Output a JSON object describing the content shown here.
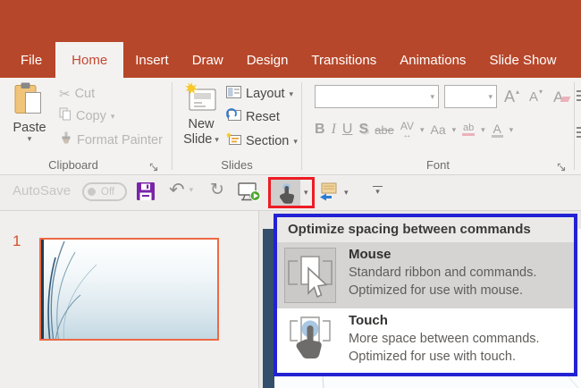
{
  "tabs": {
    "items": [
      {
        "label": "File"
      },
      {
        "label": "Home"
      },
      {
        "label": "Insert"
      },
      {
        "label": "Draw"
      },
      {
        "label": "Design"
      },
      {
        "label": "Transitions"
      },
      {
        "label": "Animations"
      },
      {
        "label": "Slide Show"
      }
    ],
    "active": "Home"
  },
  "ribbon": {
    "clipboard": {
      "group_label": "Clipboard",
      "paste_label": "Paste",
      "cut_label": "Cut",
      "copy_label": "Copy",
      "format_painter_label": "Format Painter"
    },
    "slides": {
      "group_label": "Slides",
      "new_slide_line1": "New",
      "new_slide_line2": "Slide",
      "layout_label": "Layout",
      "reset_label": "Reset",
      "section_label": "Section"
    },
    "font": {
      "group_label": "Font",
      "bold": "B",
      "italic": "I",
      "underline": "U",
      "shadow": "S",
      "strikethrough": "abe",
      "spacing": "AV",
      "spacing_arrow": "↔",
      "case": "Aa",
      "highlight": "ab",
      "color": "A",
      "grow": "A",
      "shrink": "A",
      "clear": "A"
    }
  },
  "qat": {
    "autosave_label": "AutoSave",
    "autosave_state": "Off"
  },
  "slide_panel": {
    "slide_number": "1"
  },
  "menu": {
    "title": "Optimize spacing between commands",
    "items": [
      {
        "label": "Mouse",
        "line1": "Standard ribbon and commands.",
        "line2": "Optimized for use with mouse.",
        "selected": true
      },
      {
        "label": "Touch",
        "line1": "More space between commands.",
        "line2": "Optimized for use with touch.",
        "selected": false
      }
    ]
  },
  "glyphs": {
    "caret": "▾",
    "up_caret": "▴",
    "cut": "✂",
    "undo": "↶",
    "redo": "↻"
  },
  "colors": {
    "brand_red": "#b7472a",
    "highlight_box_red": "#ed1c24",
    "menu_border_blue": "#2222d4",
    "thumb_border_orange": "#ed6a45",
    "save_purple": "#7a24a8"
  }
}
